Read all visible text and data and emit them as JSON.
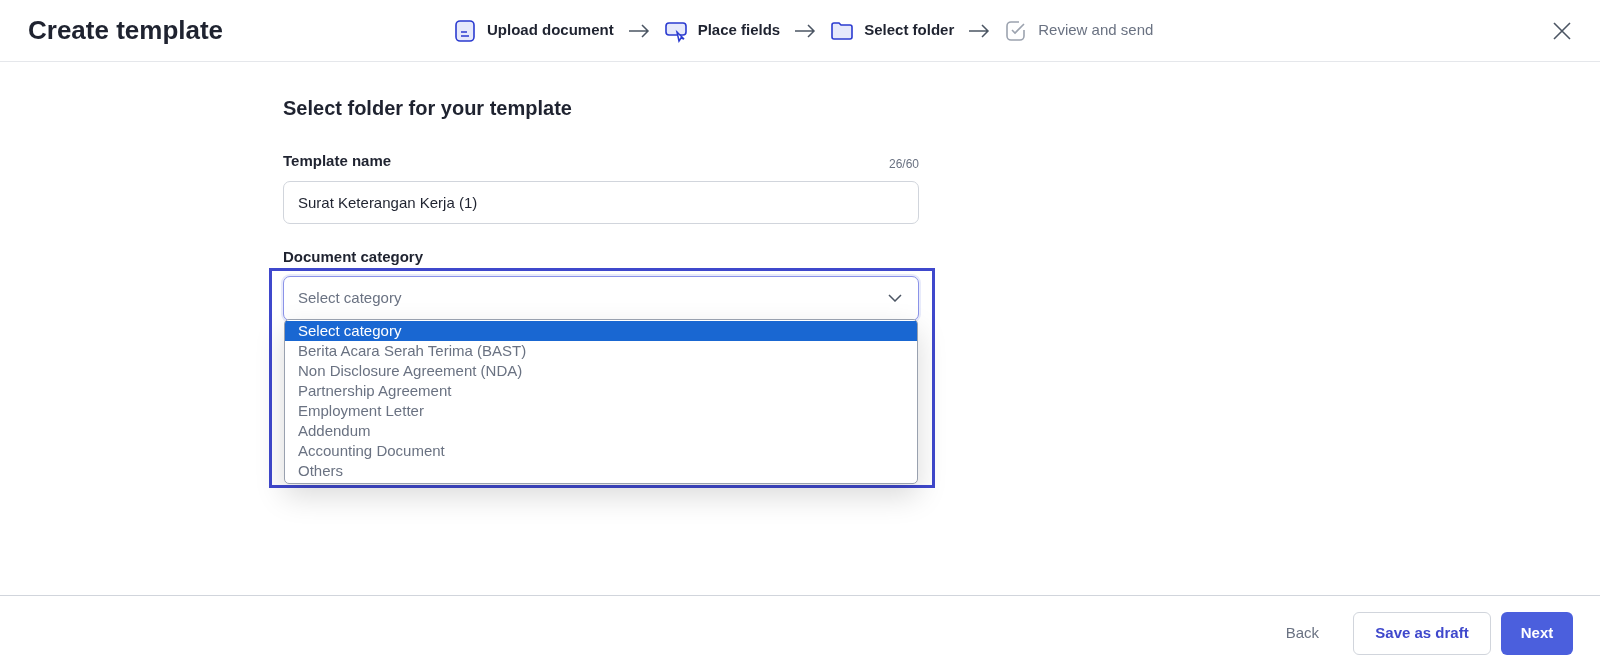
{
  "header": {
    "title": "Create template",
    "steps": [
      {
        "label": "Upload document",
        "kind": "document",
        "reached": true
      },
      {
        "label": "Place fields",
        "kind": "pointer",
        "reached": true
      },
      {
        "label": "Select folder",
        "kind": "folder",
        "reached": true
      },
      {
        "label": "Review and send",
        "kind": "check",
        "reached": false
      }
    ]
  },
  "form": {
    "heading": "Select folder for your template",
    "template_name": {
      "label": "Template name",
      "counter": "26/60",
      "value": "Surat Keterangan Kerja (1)"
    },
    "category": {
      "label": "Document category",
      "placeholder": "Select category",
      "options": [
        {
          "label": "Select category",
          "selected": true
        },
        {
          "label": "Berita Acara Serah Terima (BAST)",
          "selected": false
        },
        {
          "label": "Non Disclosure Agreement (NDA)",
          "selected": false
        },
        {
          "label": "Partnership Agreement",
          "selected": false
        },
        {
          "label": "Employment Letter",
          "selected": false
        },
        {
          "label": "Addendum",
          "selected": false
        },
        {
          "label": "Accounting Document",
          "selected": false
        },
        {
          "label": "Others",
          "selected": false
        }
      ]
    }
  },
  "footer": {
    "back": "Back",
    "save_draft": "Save as draft",
    "next": "Next"
  }
}
